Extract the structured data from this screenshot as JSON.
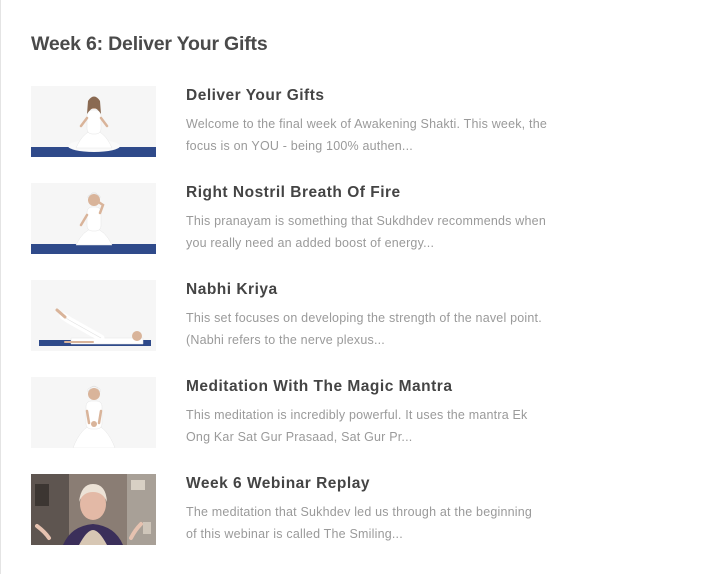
{
  "section": {
    "title": "Week 6: Deliver Your Gifts"
  },
  "lessons": [
    {
      "title": "Deliver Your Gifts",
      "desc_line1": "Welcome to the final week of Awakening Shakti. This week, the",
      "desc_line2": "focus is on YOU - being 100% authen...",
      "thumbnail_icon": "seated-woman-thumbnail"
    },
    {
      "title": "Right Nostril Breath Of Fire",
      "desc_line1": "This pranayam is something that Sukdhdev recommends when",
      "desc_line2": "you really need an added boost of energy...",
      "thumbnail_icon": "breathing-woman-thumbnail"
    },
    {
      "title": "Nabhi Kriya",
      "desc_line1": "This set focuses on developing the strength of the navel point.",
      "desc_line2": "(Nabhi refers to the nerve plexus...",
      "thumbnail_icon": "leg-raise-thumbnail"
    },
    {
      "title": "Meditation With The Magic Mantra",
      "desc_line1": "This meditation is incredibly powerful. It uses the mantra Ek",
      "desc_line2": "Ong Kar Sat Gur Prasaad, Sat Gur Pr...",
      "thumbnail_icon": "meditating-woman-thumbnail"
    },
    {
      "title": "Week 6 Webinar Replay",
      "desc_line1": "The meditation that Sukhdev led us through at the beginning",
      "desc_line2": "of this webinar is called The Smiling...",
      "thumbnail_icon": "webinar-video-thumbnail"
    }
  ]
}
